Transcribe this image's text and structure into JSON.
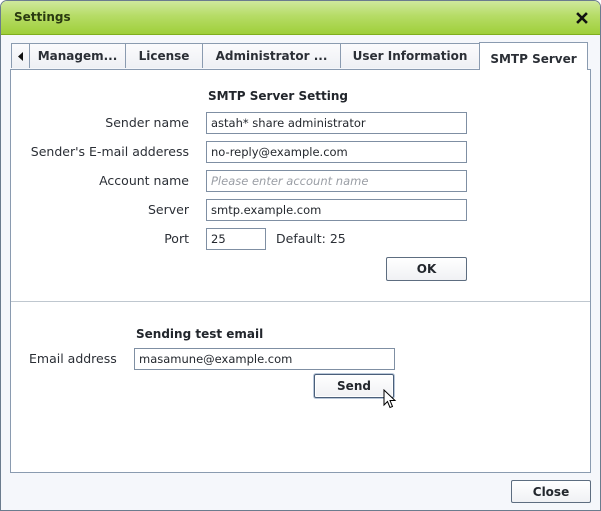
{
  "window": {
    "title": "Settings",
    "close_glyph": "✕"
  },
  "tabs": {
    "scroll_left_glyph": "◀",
    "items": [
      {
        "label": "Managem...",
        "active": false
      },
      {
        "label": "License",
        "active": false
      },
      {
        "label": "Administrator ...",
        "active": false
      },
      {
        "label": "User Information",
        "active": false
      },
      {
        "label": "SMTP Server",
        "active": true
      }
    ]
  },
  "smtp": {
    "section_title": "SMTP Server Setting",
    "sender_name": {
      "label": "Sender name",
      "value": "astah* share administrator",
      "placeholder": ""
    },
    "sender_email": {
      "label": "Sender's E-mail adderess",
      "value": "no-reply@example.com",
      "placeholder": ""
    },
    "account_name": {
      "label": "Account name",
      "value": "",
      "placeholder": "Please enter account name"
    },
    "server": {
      "label": "Server",
      "value": "smtp.example.com",
      "placeholder": ""
    },
    "port": {
      "label": "Port",
      "value": "25",
      "default_hint": "Default: 25"
    },
    "ok_label": "OK"
  },
  "test_email": {
    "section_title": "Sending test email",
    "email": {
      "label": "Email address",
      "value": "masamune@example.com"
    },
    "send_label": "Send"
  },
  "footer": {
    "close_label": "Close"
  },
  "colors": {
    "title_bar_green": "#9fcf3a",
    "border_blue_gray": "#8a9bb0"
  }
}
